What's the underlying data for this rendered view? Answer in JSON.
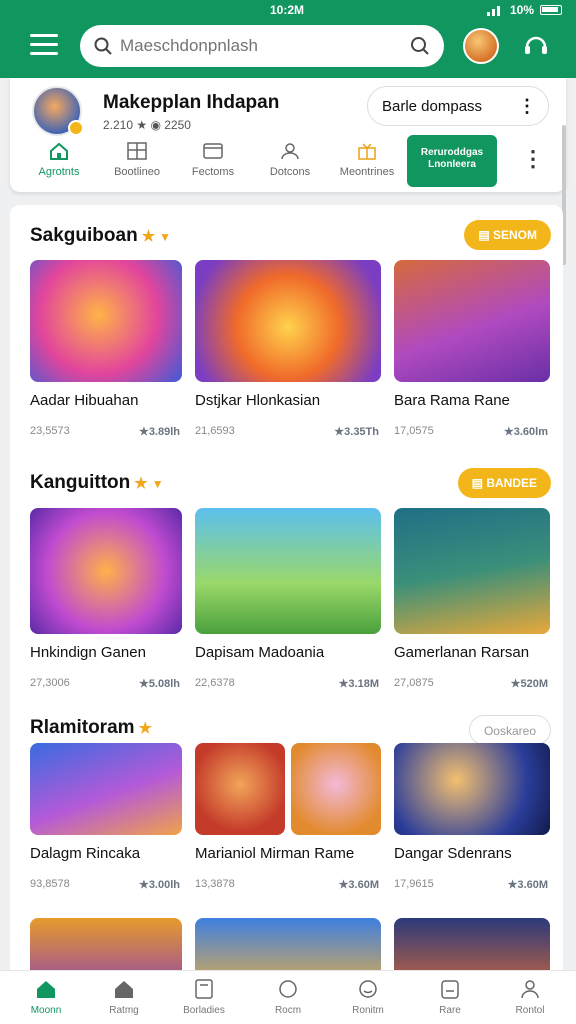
{
  "status": {
    "time": "10:2M",
    "battery": "10%"
  },
  "search": {
    "placeholder": "Maeschdonpnlash"
  },
  "profile": {
    "name": "Makepplan Ihdapan",
    "stats": "2.210 ★ ◉ 2250",
    "pill": "Barle dompass"
  },
  "categories": [
    {
      "label": "Agrotnts",
      "icon": "home-icon",
      "active": true
    },
    {
      "label": "Bootlineo",
      "icon": "grid-icon"
    },
    {
      "label": "Fectoms",
      "icon": "folder-icon"
    },
    {
      "label": "Dotcons",
      "icon": "people-icon"
    },
    {
      "label": "Meontrines",
      "icon": "gift-icon"
    }
  ],
  "promo": {
    "label": "Reruroddgas Lnonleera"
  },
  "sections": [
    {
      "title": "Sakguiboan",
      "button": "SENOM",
      "tiles": [
        {
          "name": "Aadar Hibuahan",
          "meta": "23,5573",
          "rating": "★3.89lh"
        },
        {
          "name": "Dstjkar Hlonkasian",
          "meta": "21,6593",
          "rating": "★3.35Th"
        },
        {
          "name": "Bara Rama Rane",
          "meta": "17,0575",
          "rating": "★3.60lm"
        }
      ]
    },
    {
      "title": "Kanguitton",
      "button": "BANDEE",
      "tiles": [
        {
          "name": "Hnkindign Ganen",
          "meta": "27,3006",
          "rating": "★5.08lh"
        },
        {
          "name": "Dapisam Madoania",
          "meta": "22,6378",
          "rating": "★3.18M"
        },
        {
          "name": "Gamerlanan Rarsan",
          "meta": "27,0875",
          "rating": "★520M"
        }
      ]
    },
    {
      "title": "Rlamitoram",
      "button": "Ooskareo",
      "tiles": [
        {
          "name": "Dalagm Rincaka",
          "meta": "93,8578",
          "rating": "★3.00lh"
        },
        {
          "name": "Marianiol Mirman Rame",
          "meta": "13,3878",
          "rating": "★3.60M"
        },
        {
          "name": "Dangar Sdenrans",
          "meta": "17,9615",
          "rating": "★3.60M"
        }
      ]
    }
  ],
  "bottom_nav": [
    {
      "label": "Moonn",
      "icon": "home-icon",
      "active": true
    },
    {
      "label": "Ratmg",
      "icon": "house-icon"
    },
    {
      "label": "Borladies",
      "icon": "book-icon"
    },
    {
      "label": "Rocm",
      "icon": "chat-icon"
    },
    {
      "label": "Ronitm",
      "icon": "smile-icon"
    },
    {
      "label": "Rare",
      "icon": "bag-icon"
    },
    {
      "label": "Rontol",
      "icon": "person-icon"
    }
  ],
  "colors": {
    "brand": "#129660",
    "accent": "#f2b61b"
  }
}
